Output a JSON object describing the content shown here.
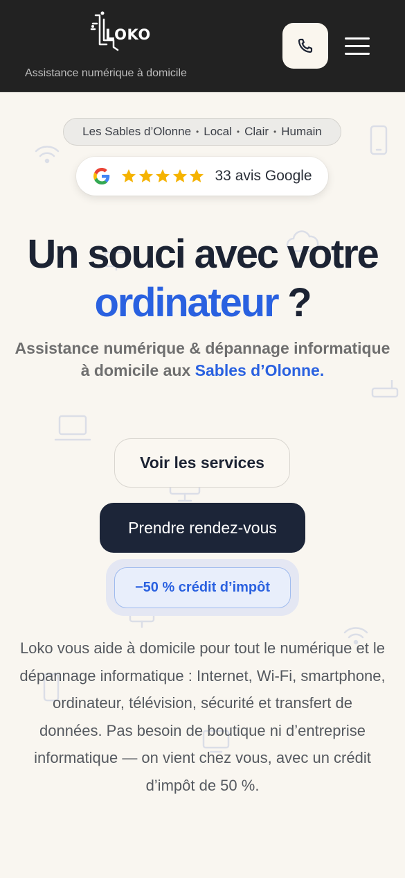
{
  "header": {
    "logo_text": "LOKO",
    "tagline": "Assistance numérique à domicile",
    "call_icon": "phone-icon",
    "menu_icon": "hamburger-menu-icon"
  },
  "location_pill": {
    "items": [
      "Les Sables d’Olonne",
      "Local",
      "Clair",
      "Humain"
    ],
    "separator": "•"
  },
  "reviews": {
    "rating_stars": 5,
    "text": "33 avis Google",
    "icon": "google-icon"
  },
  "hero": {
    "title_line1": "Un souci avec votre",
    "title_accent": "ordinateur",
    "title_end": " ?",
    "subtitle_part1": "Assistance numérique & dépannage informatique à domicile aux ",
    "subtitle_link": "Sables d’Olonne",
    "subtitle_end": "."
  },
  "buttons": {
    "services": "Voir les services",
    "appointment": "Prendre rendez-vous",
    "tax_credit": "−50 % crédit d’impôt"
  },
  "description": "Loko vous aide à domicile pour tout le numérique et le dépannage informatique : Internet, Wi-Fi, smartphone, ordinateur, télévision, sécurité et transfert de données. Pas besoin de boutique ni d’entreprise informatique — on vient chez vous, avec un crédit d’impôt de 50 %.",
  "colors": {
    "header_bg": "#222222",
    "page_bg": "#f9f6f0",
    "accent_blue": "#2a61e0",
    "dark_button": "#1c2538",
    "star": "#f5b301"
  }
}
